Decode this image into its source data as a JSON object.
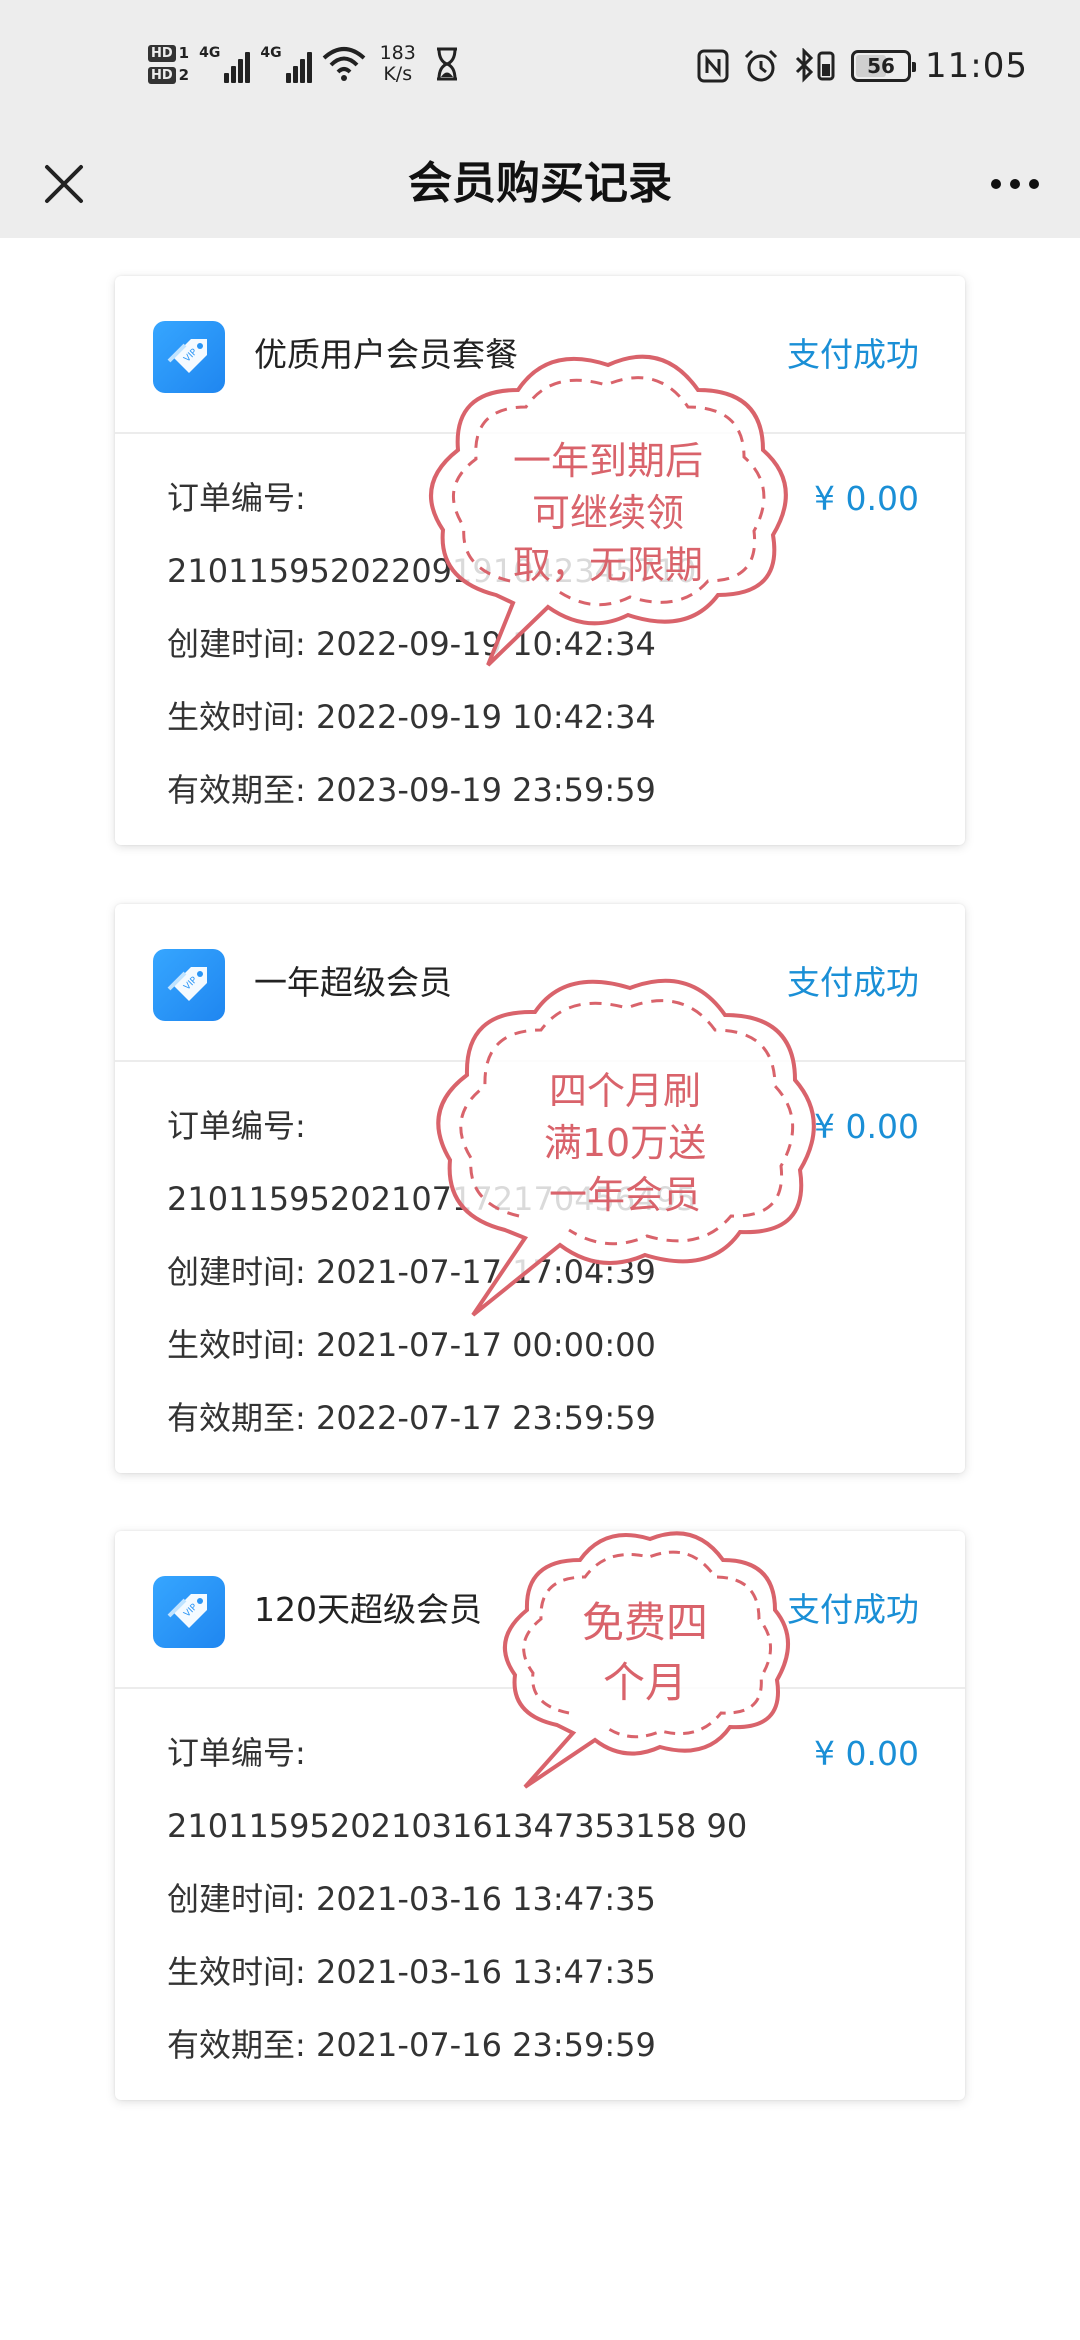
{
  "status_bar": {
    "hd1": "HD",
    "hd1_num": "1",
    "hd2": "HD",
    "hd2_num": "2",
    "net1": "4G",
    "net2": "4G",
    "speed_value": "183",
    "speed_unit": "K/s",
    "battery": "56",
    "time": "11:05"
  },
  "header": {
    "title": "会员购买记录"
  },
  "labels": {
    "order_no": "订单编号:",
    "created": "创建时间:",
    "effective": "生效时间:",
    "valid_until": "有效期至:"
  },
  "orders": [
    {
      "plan_name": "优质用户会员套餐",
      "status": "支付成功",
      "price": "¥ 0.00",
      "order_no": "21011595202209191042345710",
      "created_time": "2022-09-19 10:42:34",
      "effective_time": "2022-09-19 10:42:34",
      "valid_until": "2023-09-19 23:59:59"
    },
    {
      "plan_name": "一年超级会员",
      "status": "支付成功",
      "price": "¥ 0.00",
      "order_no": "21011595202107172170456495",
      "created_time": "2021-07-17 17:04:39",
      "effective_time": "2021-07-17 00:00:00",
      "valid_until": "2022-07-17 23:59:59"
    },
    {
      "plan_name": "120天超级会员",
      "status": "支付成功",
      "price": "¥ 0.00",
      "order_no": "21011595202103161347353158 90",
      "created_time": "2021-03-16 13:47:35",
      "effective_time": "2021-03-16 13:47:35",
      "valid_until": "2021-07-16 23:59:59"
    }
  ],
  "stickers": [
    {
      "lines": [
        "一年到期后",
        "可继续领",
        "取，无限期"
      ]
    },
    {
      "lines": [
        "四个月刷",
        "满10万送",
        "一年会员"
      ]
    },
    {
      "lines": [
        "免费四",
        "个月"
      ]
    }
  ],
  "colors": {
    "accent": "#1a8fd6",
    "sticker": "#d9636b",
    "bar_bg": "#ededed"
  }
}
